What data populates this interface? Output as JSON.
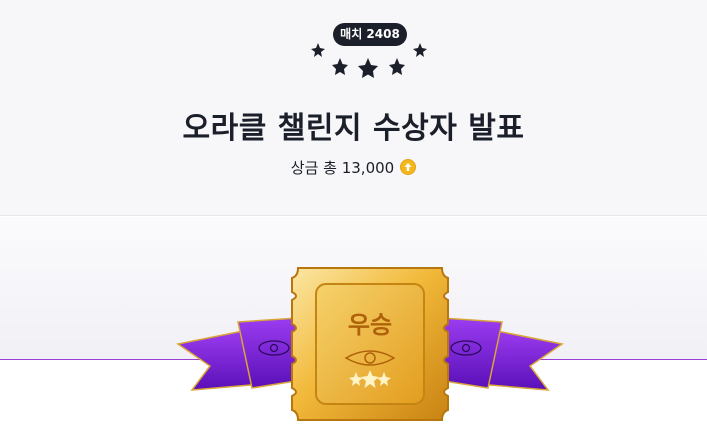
{
  "match_badge": "매치 2408",
  "title": "오라클 챌린지 수상자 발표",
  "prize": {
    "label": "상금 총 13,000",
    "coin_icon": "coin-icon"
  },
  "ticket": {
    "label": "우승"
  },
  "colors": {
    "dark": "#1b1f2a",
    "gold": "#e8a21c",
    "ribbon": "#7a1fe0",
    "accent_line": "#9b3fd3"
  }
}
